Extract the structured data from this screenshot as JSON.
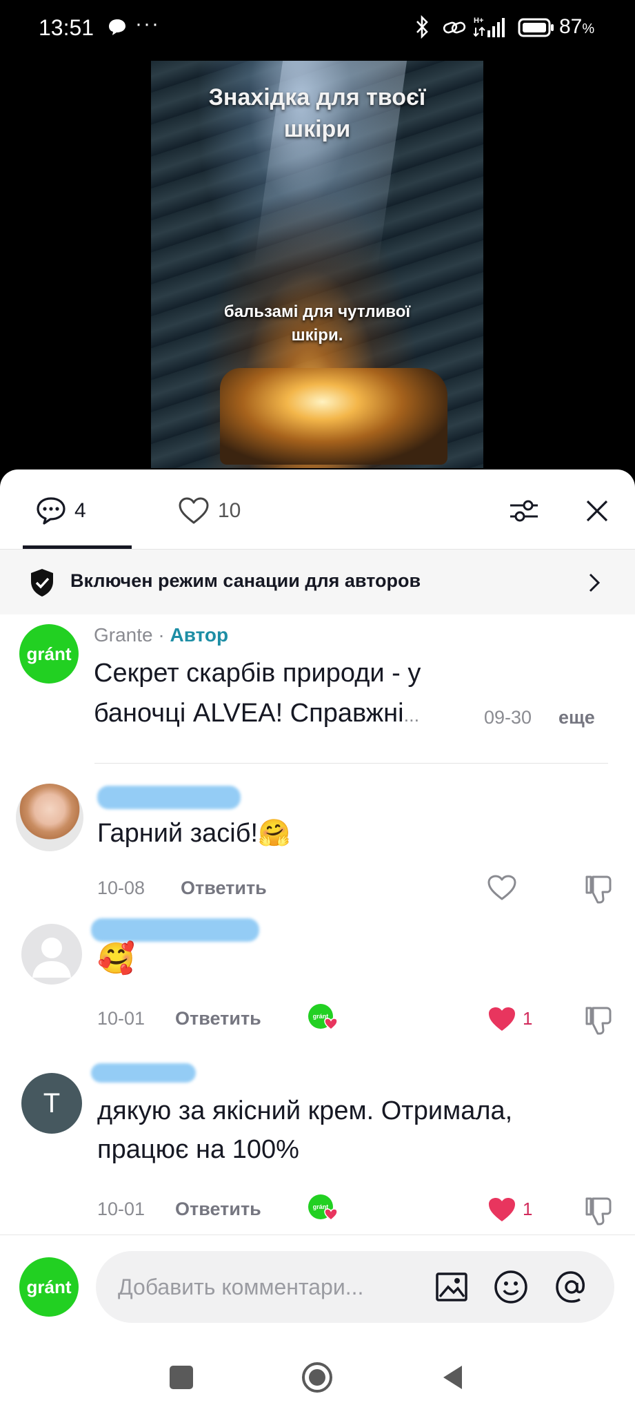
{
  "status_bar": {
    "time": "13:51",
    "dots": "···",
    "battery": "87",
    "battery_unit": "%"
  },
  "video": {
    "title_line1": "Знахідка для твоєї",
    "title_line2": "шкіри",
    "caption_line1": "бальзамі для чутливої",
    "caption_line2": "шкіри."
  },
  "tabs": {
    "comments_count": "4",
    "likes_count": "10"
  },
  "notice": {
    "text": "Включен режим санации для авторов"
  },
  "comments": [
    {
      "username": "Grante",
      "separator": " · ",
      "author_tag": "Автор",
      "text_line1": "Секрет скарбів природи - у",
      "text_line2": "баночці ALVEA! Справжні",
      "ellipsis": "...",
      "date": "09-30",
      "more": "еще"
    },
    {
      "text": "Гарний засіб!🤗",
      "date": "10-08",
      "reply": "Ответить"
    },
    {
      "text": "🥰",
      "date": "10-01",
      "reply": "Ответить",
      "likes": "1"
    },
    {
      "avatar_letter": "T",
      "text_line1": "дякую за якісний крем. Отримала,",
      "text_line2": "працює на 100%",
      "date": "10-01",
      "reply": "Ответить",
      "likes": "1"
    }
  ],
  "composer": {
    "placeholder": "Добавить комментари..."
  },
  "brand": {
    "logo_text": "gránt",
    "accent": "#22d022",
    "like_color": "#d12a5b",
    "author_color": "#1d8ea5"
  }
}
